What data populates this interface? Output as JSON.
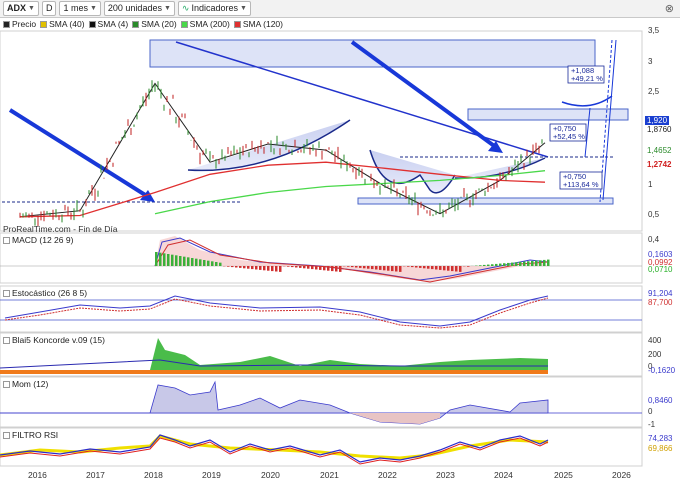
{
  "toolbar": {
    "symbol": "ADX",
    "period_code": "D",
    "timeframe": "1 mes",
    "units": "200 unidades",
    "indicators": "Indicadores"
  },
  "legend": {
    "items": [
      {
        "label": "Precio",
        "color": "#222222"
      },
      {
        "label": "SMA (40)",
        "color": "#e0c000"
      },
      {
        "label": "SMA (4)",
        "color": "#111111"
      },
      {
        "label": "SMA (20)",
        "color": "#2a8a2a"
      },
      {
        "label": "SMA (200)",
        "color": "#4ad84a"
      },
      {
        "label": "SMA (120)",
        "color": "#e03030"
      }
    ]
  },
  "source_text": "ProRealTime.com - Fin de Día",
  "panes": {
    "macd": "MACD (12 26 9)",
    "stoch": "Estocástico (26 8 5)",
    "blai5": "Blai5 Koncorde v.09 (15)",
    "mom": "Mom (12)",
    "filtro": "FILTRO RSI"
  },
  "annotations": {
    "upper_box_a": "+1,088",
    "upper_box_b": "+49,21 %",
    "mid_box_a": "+0,750",
    "mid_box_b": "+52,45 %",
    "low_box_a": "+0,750",
    "low_box_b": "+113,64 %"
  },
  "price_axis": [
    "3,5",
    "3",
    "2,5",
    "2",
    "1,5",
    "1",
    "0,5"
  ],
  "price_tags": [
    {
      "text": "1,920",
      "bg": "#1a3fd0",
      "fg": "#ffffff"
    },
    {
      "text": "1,8760",
      "bg": "#ffffff",
      "fg": "#222222"
    },
    {
      "text": "1,4652",
      "bg": "#ffffff",
      "fg": "#2a8a2a"
    },
    {
      "text": "1,2742",
      "bg": "#ffffff",
      "fg": "#d02020"
    }
  ],
  "macd_axis": [
    "0,4",
    "0,1603",
    "0,0992",
    "0,0710"
  ],
  "stoch_axis": [
    "91,204",
    "87,700"
  ],
  "blai5_axis": [
    "400",
    "200",
    "0",
    "-0,1620"
  ],
  "mom_axis": [
    "0,8460",
    "0",
    "-1"
  ],
  "filtro_axis": [
    "74,283",
    "69,866"
  ],
  "x_labels": [
    "2016",
    "2017",
    "2018",
    "2019",
    "2020",
    "2021",
    "2022",
    "2023",
    "2024",
    "2025",
    "2026"
  ],
  "chart_data": {
    "type": "line",
    "title": "ADX",
    "xlabel": "",
    "ylabel": "",
    "x": [
      "2016",
      "2017",
      "2018",
      "2019",
      "2020",
      "2021",
      "2022",
      "2023",
      "2024",
      "2024-10"
    ],
    "series": [
      {
        "name": "Precio",
        "values": [
          0.7,
          0.8,
          2.9,
          1.6,
          1.9,
          1.8,
          1.2,
          0.75,
          1.3,
          1.92
        ]
      },
      {
        "name": "SMA (120)",
        "values": [
          0.7,
          0.72,
          1.1,
          1.4,
          1.55,
          1.6,
          1.5,
          1.4,
          1.3,
          1.27
        ]
      },
      {
        "name": "SMA (200)",
        "values": [
          null,
          null,
          0.75,
          0.95,
          1.1,
          1.2,
          1.25,
          1.3,
          1.38,
          1.46
        ]
      }
    ],
    "ylim": [
      0.3,
      3.6
    ],
    "last_values": {
      "price": 1.92,
      "sma4": 1.876,
      "sma20": 1.4652,
      "sma120": 1.2742
    }
  }
}
